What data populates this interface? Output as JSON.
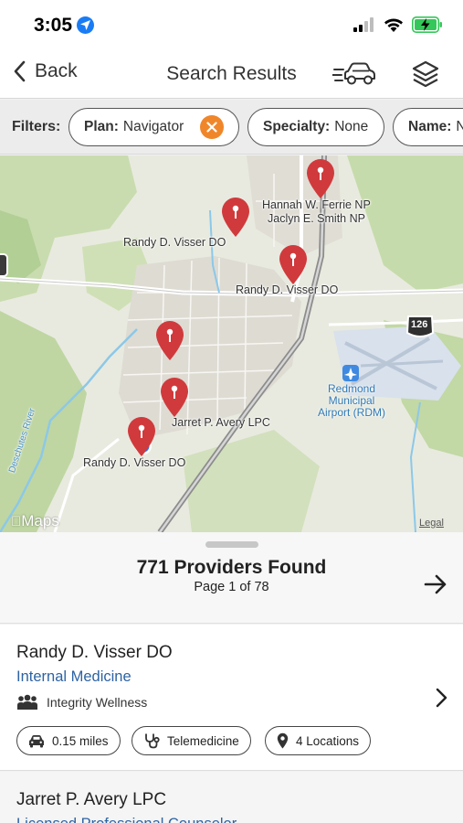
{
  "status_bar": {
    "time": "3:05",
    "icons": [
      "location-arrow-icon",
      "cellular-signal-icon",
      "wifi-icon",
      "battery-charging-icon"
    ]
  },
  "nav": {
    "back_label": "Back",
    "title": "Search Results",
    "icons": [
      "chevron-left-icon",
      "car-icon",
      "layers-icon"
    ]
  },
  "filters": {
    "label": "Filters:",
    "chips": [
      {
        "key": "Plan:",
        "value": "Navigator",
        "removable": true
      },
      {
        "key": "Specialty:",
        "value": "None"
      },
      {
        "key": "Name:",
        "value": "N"
      }
    ]
  },
  "map": {
    "labels": {
      "ferrie": "Hannah W. Ferrie NP",
      "smith": "Jaclyn E. Smith NP",
      "visser_1": "Randy D. Visser DO",
      "visser_2": "Randy D. Visser DO",
      "avery": "Jarret P. Avery LPC",
      "visser_3": "Randy D. Visser DO",
      "highway": "126",
      "airport_line1": "Redmond",
      "airport_line2": "Municipal",
      "airport_line3": "Airport (RDM)",
      "river": "Deschutes River",
      "logo": "Maps",
      "legal": "Legal"
    },
    "pin_color": "#d03a3c",
    "pin_count": 6
  },
  "results": {
    "count_text": "771 Providers Found",
    "page_text": "Page 1 of 78"
  },
  "providers": [
    {
      "name": "Randy D. Visser DO",
      "specialty": "Internal Medicine",
      "organization": "Integrity Wellness",
      "tags": {
        "distance": "0.15 miles",
        "telemedicine": "Telemedicine",
        "locations": "4 Locations"
      }
    },
    {
      "name": "Jarret P. Avery LPC",
      "specialty": "Licensed Professional Counselor"
    }
  ],
  "colors": {
    "accent_orange": "#f0862a",
    "link_blue": "#2d63a3",
    "location_blue": "#1a7cf5",
    "battery_green": "#34c759"
  }
}
